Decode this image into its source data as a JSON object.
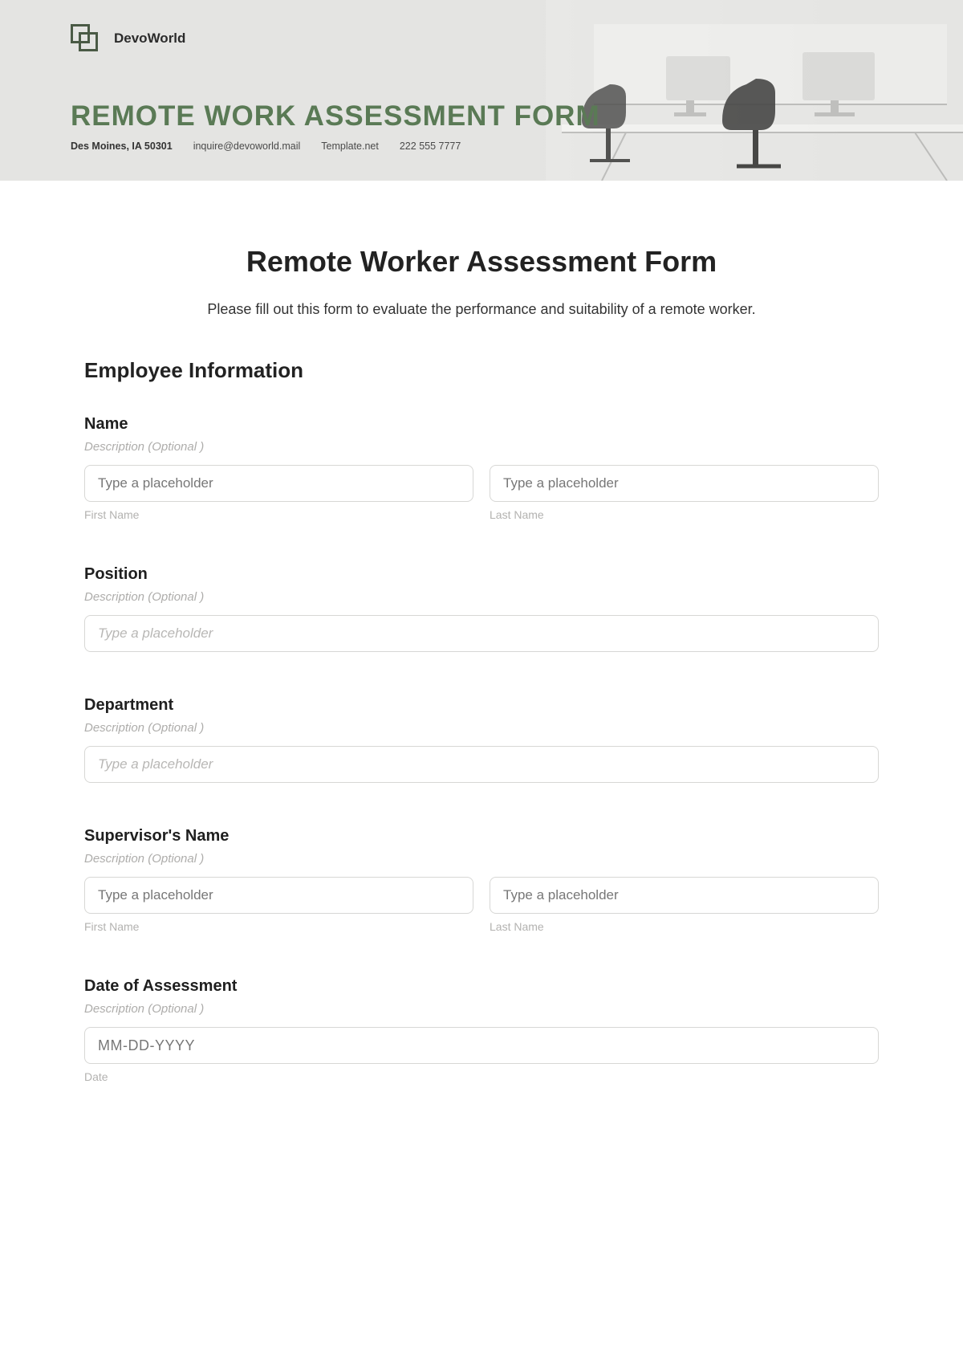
{
  "header": {
    "brand": "DevoWorld",
    "title": "REMOTE WORK ASSESSMENT FORM",
    "meta": {
      "address": "Des Moines, IA 50301",
      "email": "inquire@devoworld.mail",
      "site": "Template.net",
      "phone": "222 555 7777"
    }
  },
  "form": {
    "title": "Remote Worker Assessment Form",
    "intro": "Please fill out this form to evaluate the performance and suitability of a remote worker.",
    "section1_title": "Employee Information",
    "desc_optional": "Description (Optional )",
    "placeholder_type": "Type a placeholder",
    "placeholder_type_italic": "Type a placeholder",
    "sub_first": "First Name",
    "sub_last": "Last Name",
    "sub_date": "Date",
    "date_placeholder": "MM-DD-YYYY",
    "fields": {
      "name_label": "Name",
      "position_label": "Position",
      "department_label": "Department",
      "supervisor_label": "Supervisor's Name",
      "date_label": "Date of Assessment"
    }
  }
}
